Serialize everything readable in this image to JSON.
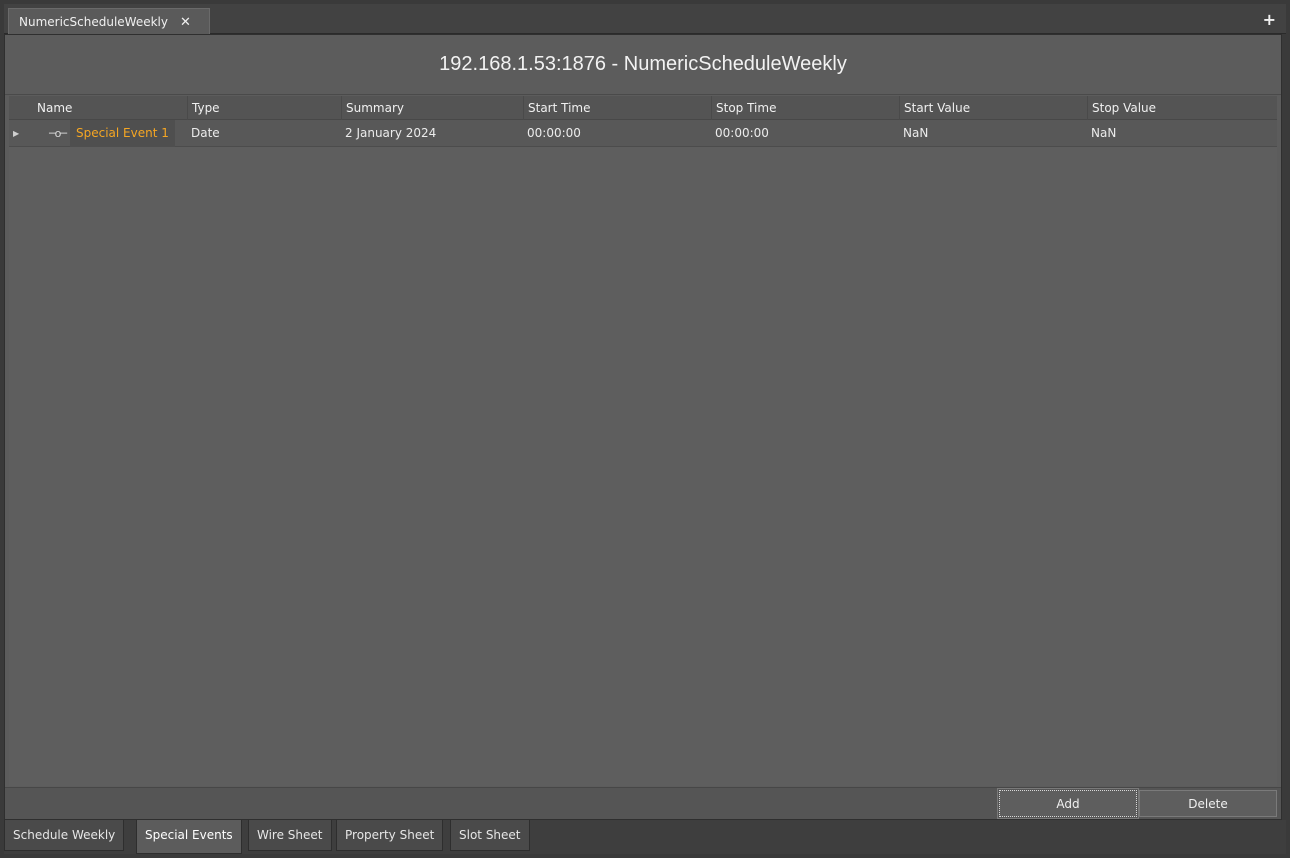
{
  "doc_tab": {
    "title": "NumericScheduleWeekly",
    "close_glyph": "✕"
  },
  "new_tab_glyph": "+",
  "panel": {
    "title": "192.168.1.53:1876 - NumericScheduleWeekly"
  },
  "table": {
    "columns": [
      "Name",
      "Type",
      "Summary",
      "Start Time",
      "Stop Time",
      "Start Value",
      "Stop Value"
    ],
    "rows": [
      {
        "name": "Special Event 1",
        "type": "Date",
        "summary": "2 January 2024",
        "start_time": "00:00:00",
        "stop_time": "00:00:00",
        "start_value": "NaN",
        "stop_value": "NaN",
        "icon": "link-icon"
      }
    ]
  },
  "buttons": {
    "add": "Add",
    "delete": "Delete"
  },
  "view_tabs": [
    "Schedule Weekly",
    "Special Events",
    "Wire Sheet",
    "Property Sheet",
    "Slot Sheet"
  ],
  "active_view_tab": "Special Events",
  "colors": {
    "accent_name": "#f5a623",
    "background": "#5c5c5c"
  }
}
